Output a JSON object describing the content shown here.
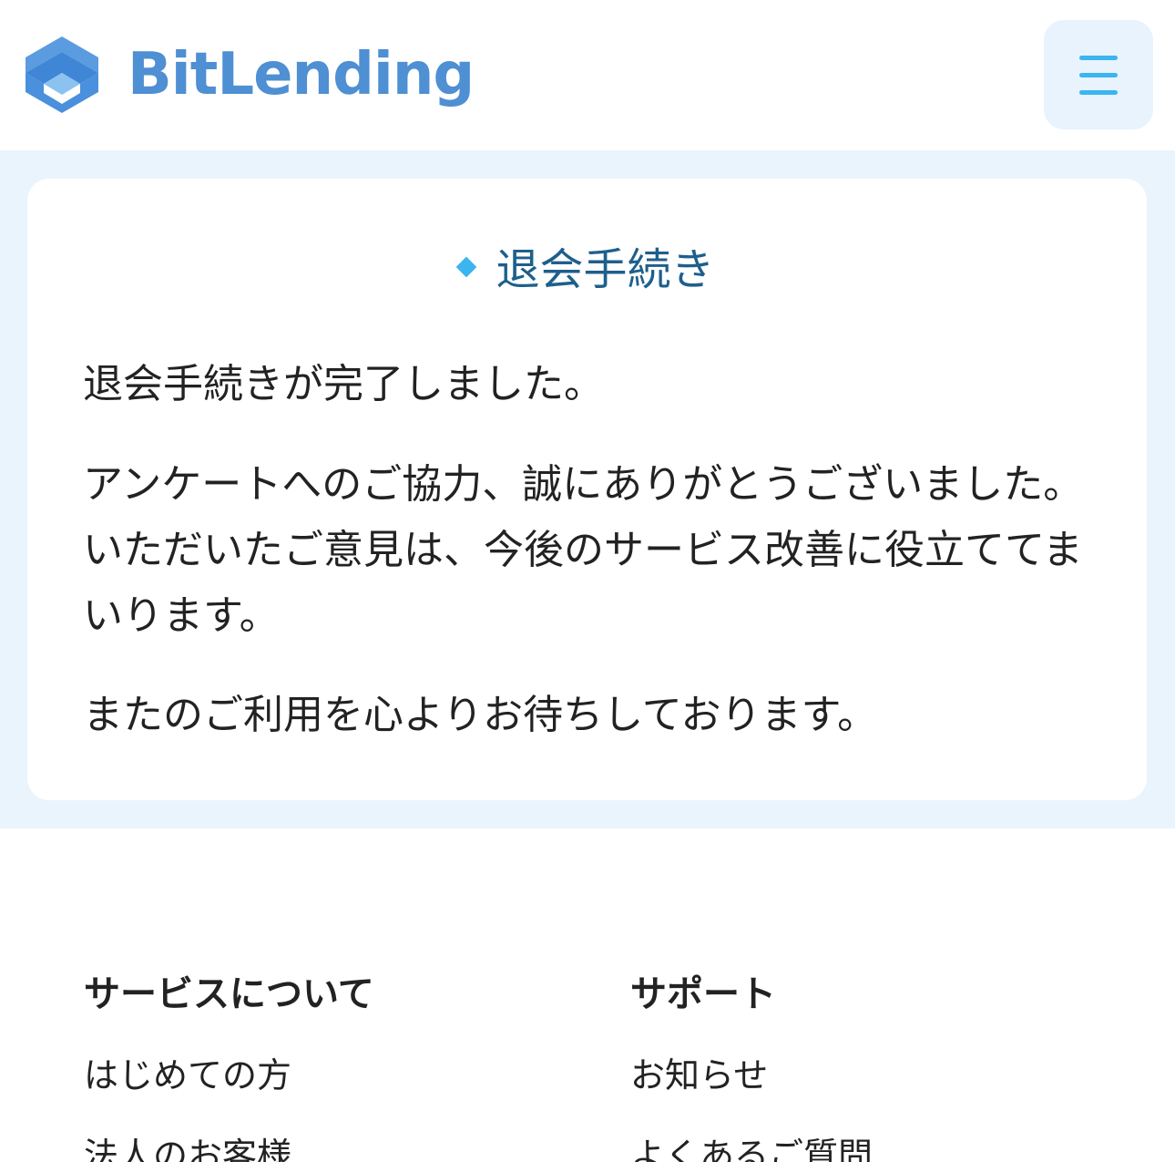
{
  "header": {
    "logo_text": "BitLending",
    "menu_label": "☰"
  },
  "colors": {
    "brand_blue": "#4f8fd3",
    "accent_cyan": "#3bb4ef",
    "title_navy": "#1e5f8c",
    "band_bg": "#eaf4fd"
  },
  "card": {
    "title": "退会手続き",
    "message1": "退会手続きが完了しました。",
    "message2": "アンケートへのご協力、誠にありがとうございました。いただいたご意見は、今後のサービス改善に役立ててまいります。",
    "message3": "またのご利用を心よりお待ちしております。"
  },
  "footer": {
    "columns": [
      {
        "heading": "サービスについて",
        "links": [
          "はじめての方",
          "法人のお客様"
        ]
      },
      {
        "heading": "サポート",
        "links": [
          "お知らせ",
          "よくあるご質問"
        ]
      }
    ]
  }
}
